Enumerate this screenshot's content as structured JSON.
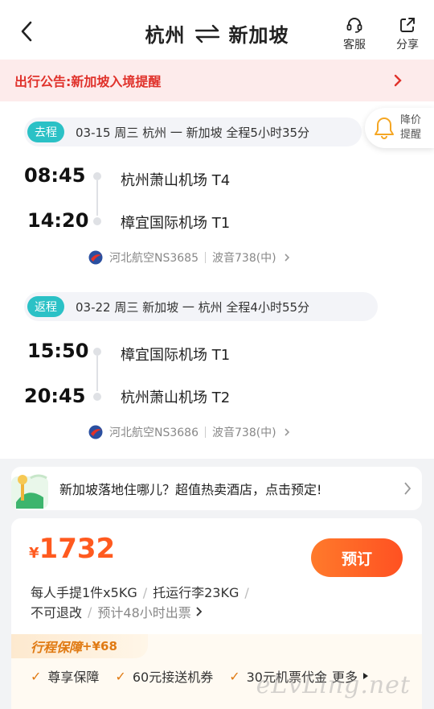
{
  "header": {
    "from_city": "杭州",
    "to_city": "新加坡",
    "service_label": "客服",
    "share_label": "分享"
  },
  "notice": {
    "text": "出行公告:新加坡入境提醒"
  },
  "price_alert": {
    "label": "降价提醒"
  },
  "outbound": {
    "tag": "去程",
    "summary": "03-15 周三   杭州 一 新加坡   全程5小时35分",
    "dep_time": "08:45",
    "dep_airport": "杭州萧山机场 T4",
    "arr_time": "14:20",
    "arr_airport": "樟宜国际机场 T1",
    "flight": "河北航空NS3685",
    "aircraft": "波音738(中)"
  },
  "return": {
    "tag": "返程",
    "summary": "03-22 周三   新加坡 一 杭州   全程4小时55分",
    "dep_time": "15:50",
    "dep_airport": "樟宜国际机场 T1",
    "arr_time": "20:45",
    "arr_airport": "杭州萧山机场 T2",
    "flight": "河北航空NS3686",
    "aircraft": "波音738(中)"
  },
  "hotel_banner": {
    "text": "新加坡落地住哪儿？超值热卖酒店，点击预定!"
  },
  "price_card": {
    "currency": "¥",
    "price": "1732",
    "book_label": "预订",
    "carry_on": "每人手提1件x5KG",
    "checked": "托运行李23KG",
    "refund": "不可退改",
    "ticketing": "预计48小时出票"
  },
  "guarantee": {
    "title": "行程保障",
    "price": "+¥68",
    "items": [
      "尊享保障",
      "60元接送机券",
      "30元机票代金"
    ],
    "more": "更多"
  },
  "watermark": "eLvLing.net",
  "colors": {
    "accent": "#ff5a1f",
    "teal": "#2bc1c6",
    "notice_red": "#e0322b"
  }
}
